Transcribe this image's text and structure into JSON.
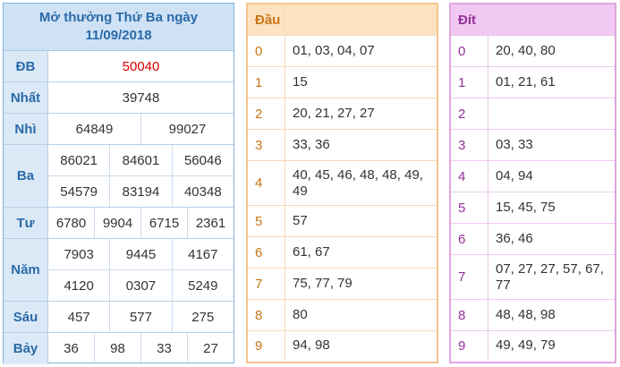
{
  "results": {
    "title_line1": "Mở thưởng Thứ Ba ngày",
    "title_line2": "11/09/2018",
    "special_color": "#e00000",
    "rows": [
      {
        "label": "ĐB",
        "lines": [
          [
            "50040"
          ]
        ]
      },
      {
        "label": "Nhất",
        "lines": [
          [
            "39748"
          ]
        ]
      },
      {
        "label": "Nhì",
        "lines": [
          [
            "64849",
            "99027"
          ]
        ]
      },
      {
        "label": "Ba",
        "lines": [
          [
            "86021",
            "84601",
            "56046"
          ],
          [
            "54579",
            "83194",
            "40348"
          ]
        ]
      },
      {
        "label": "Tư",
        "lines": [
          [
            "6780",
            "9904",
            "6715",
            "2361"
          ]
        ]
      },
      {
        "label": "Năm",
        "lines": [
          [
            "7903",
            "9445",
            "4167"
          ],
          [
            "4120",
            "0307",
            "5249"
          ]
        ]
      },
      {
        "label": "Sáu",
        "lines": [
          [
            "457",
            "577",
            "275"
          ]
        ]
      },
      {
        "label": "Bảy",
        "lines": [
          [
            "36",
            "98",
            "33",
            "27"
          ]
        ]
      }
    ]
  },
  "dau": {
    "header": "Đầu",
    "rows": [
      {
        "k": "0",
        "v": "01, 03, 04, 07"
      },
      {
        "k": "1",
        "v": "15"
      },
      {
        "k": "2",
        "v": "20, 21, 27, 27"
      },
      {
        "k": "3",
        "v": "33, 36"
      },
      {
        "k": "4",
        "v": "40, 45, 46, 48, 48, 49, 49"
      },
      {
        "k": "5",
        "v": "57"
      },
      {
        "k": "6",
        "v": "61, 67"
      },
      {
        "k": "7",
        "v": "75, 77, 79"
      },
      {
        "k": "8",
        "v": "80"
      },
      {
        "k": "9",
        "v": "94, 98"
      }
    ]
  },
  "dit": {
    "header": "Đít",
    "rows": [
      {
        "k": "0",
        "v": "20, 40, 80"
      },
      {
        "k": "1",
        "v": "01, 21, 61"
      },
      {
        "k": "2",
        "v": ""
      },
      {
        "k": "3",
        "v": "03, 33"
      },
      {
        "k": "4",
        "v": "04, 94"
      },
      {
        "k": "5",
        "v": "15, 45, 75"
      },
      {
        "k": "6",
        "v": "36, 46"
      },
      {
        "k": "7",
        "v": "07, 27, 27, 57, 67, 77"
      },
      {
        "k": "8",
        "v": "48, 48, 98"
      },
      {
        "k": "9",
        "v": "49, 49, 79"
      }
    ]
  }
}
